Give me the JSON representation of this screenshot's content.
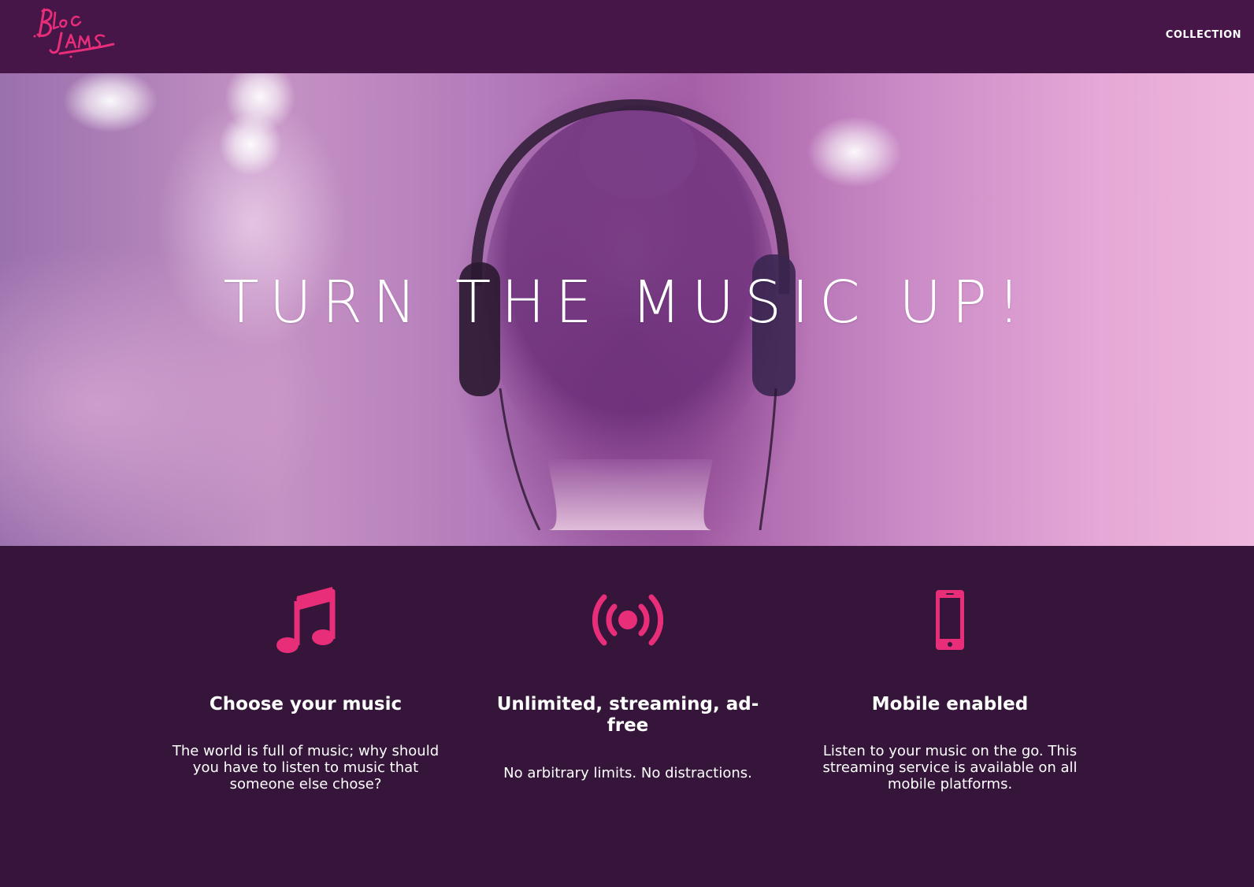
{
  "navbar": {
    "logo_text": "Bloc Jams",
    "links": [
      {
        "label": "COLLECTION"
      }
    ]
  },
  "hero": {
    "title": "TURN THE MUSIC UP!"
  },
  "features": [
    {
      "icon": "music-note-icon",
      "title": "Choose your music",
      "text": "The world is full of music; why should you have to listen to music that someone else chose?"
    },
    {
      "icon": "broadcast-icon",
      "title": "Unlimited, streaming, ad-free",
      "text": "No arbitrary limits. No distractions."
    },
    {
      "icon": "mobile-phone-icon",
      "title": "Mobile enabled",
      "text": "Listen to your music on the go. This streaming service is available on all mobile platforms."
    }
  ],
  "colors": {
    "navbar_bg": "#461649",
    "page_bg": "#35163a",
    "accent": "#e82d79",
    "text": "#ffffff"
  }
}
